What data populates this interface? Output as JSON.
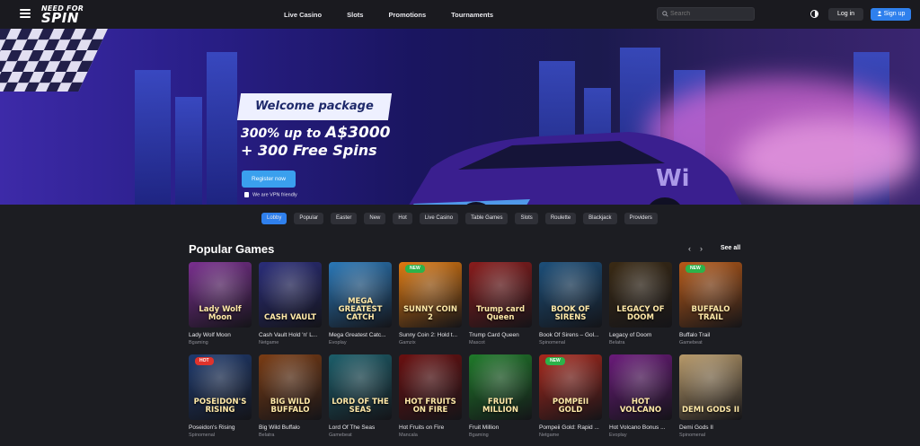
{
  "header": {
    "logo_line1": "NEED FOR",
    "logo_line2": "SPIN",
    "nav": [
      "Live Casino",
      "Slots",
      "Promotions",
      "Tournaments"
    ],
    "search_placeholder": "Search",
    "login_label": "Log in",
    "signup_label": "Sign up"
  },
  "banner": {
    "welcome": "Welcome package",
    "offer_prefix": "300% up to ",
    "offer_amount": "A$3000",
    "offer_line2": "+ 300 Free Spins",
    "cta": "Register now",
    "vpn_note": "We are VPN friendly"
  },
  "categories": {
    "items": [
      "Lobby",
      "Popular",
      "Easter",
      "New",
      "Hot",
      "Live Casino",
      "Table Games",
      "Slots",
      "Roulette",
      "Blackjack",
      "Providers"
    ],
    "active": "Lobby"
  },
  "popular": {
    "title": "Popular Games",
    "see_all": "See all",
    "games": [
      {
        "name": "Lady Wolf Moon",
        "provider": "Bgaming",
        "art": "Lady Wolf Moon",
        "badge": "",
        "bg": "#7a2f8f"
      },
      {
        "name": "Cash Vault Hold 'n' L...",
        "provider": "Netgame",
        "art": "CASH VAULT",
        "badge": "",
        "bg": "#2a2d7a"
      },
      {
        "name": "Mega Greatest Catc...",
        "provider": "Evoplay",
        "art": "MEGA GREATEST CATCH",
        "badge": "",
        "bg": "#2a78b8"
      },
      {
        "name": "Sunny Coin 2: Hold t...",
        "provider": "Gamzix",
        "art": "SUNNY COIN 2",
        "badge": "NEW",
        "bg": "#e07a10"
      },
      {
        "name": "Trump Card Queen",
        "provider": "Mascot",
        "art": "Trump card Queen",
        "badge": "",
        "bg": "#8a1c1c"
      },
      {
        "name": "Book Of Sirens – Gol...",
        "provider": "Spinomenal",
        "art": "BOOK OF SIRENS",
        "badge": "",
        "bg": "#1c4f7a"
      },
      {
        "name": "Legacy of Doom",
        "provider": "Belatra",
        "art": "LEGACY OF DOOM",
        "badge": "",
        "bg": "#3a2a14"
      },
      {
        "name": "Buffalo Trail",
        "provider": "Gamebeat",
        "art": "BUFFALO TRAIL",
        "badge": "NEW",
        "bg": "#b85a18"
      },
      {
        "name": "Poseidon's Rising",
        "provider": "Spinomenal",
        "art": "POSEIDON'S RISING",
        "badge": "HOT",
        "bg": "#1e3a6e"
      },
      {
        "name": "Big Wild Buffalo",
        "provider": "Belatra",
        "art": "BIG WILD BUFFALO",
        "badge": "",
        "bg": "#7a3c14"
      },
      {
        "name": "Lord Of The Seas",
        "provider": "Gamebeat",
        "art": "LORD OF THE SEAS",
        "badge": "",
        "bg": "#1c5e6a"
      },
      {
        "name": "Hot Fruits on Fire",
        "provider": "Mancala",
        "art": "HOT FRUITS ON FIRE",
        "badge": "",
        "bg": "#6a1010"
      },
      {
        "name": "Fruit Million",
        "provider": "Bgaming",
        "art": "FRUIT MILLION",
        "badge": "",
        "bg": "#1f7a2a"
      },
      {
        "name": "Pompeii Gold: Rapid ...",
        "provider": "Netgame",
        "art": "POMPEII GOLD",
        "badge": "NEW",
        "bg": "#a8281c"
      },
      {
        "name": "Hot Volcano Bonus ...",
        "provider": "Evoplay",
        "art": "HOT VOLCANO",
        "badge": "",
        "bg": "#6a1a7a"
      },
      {
        "name": "Demi Gods II",
        "provider": "Spinomenal",
        "art": "DEMI GODS II",
        "badge": "",
        "bg": "#b89a6a"
      }
    ]
  }
}
